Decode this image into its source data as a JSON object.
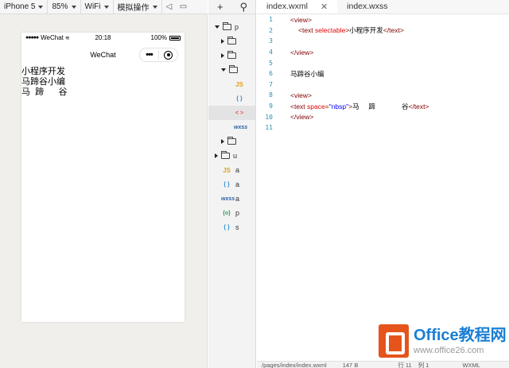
{
  "toolbar": {
    "device": "iPhone 5",
    "zoom": "85%",
    "network": "WiFi",
    "mode": "模拟操作"
  },
  "phone": {
    "carrier": "WeChat",
    "time": "20:18",
    "battery": "100%",
    "nav_title": "WeChat",
    "content": [
      "小程序开发",
      "马蹄谷小编",
      "马  蹄      谷"
    ]
  },
  "tree": {
    "rows": [
      "p",
      "",
      "",
      "",
      "JS",
      "{ }",
      "< >",
      "wxss",
      "",
      "u",
      "a",
      "a",
      "a",
      "p",
      "s"
    ]
  },
  "editor": {
    "tabs": [
      "index.wxml",
      "index.wxss"
    ],
    "lines": [
      {
        "num": "1",
        "parts": [
          [
            "kw",
            "<view>"
          ]
        ]
      },
      {
        "num": "2",
        "indent": true,
        "parts": [
          [
            "kw",
            "<text "
          ],
          [
            "at",
            "selectable"
          ],
          [
            "kw",
            ">"
          ],
          [
            "txt",
            "小程序开发"
          ],
          [
            "kw",
            "</text>"
          ]
        ]
      },
      {
        "num": "3",
        "parts": []
      },
      {
        "num": "4",
        "parts": [
          [
            "kw",
            "</view>"
          ]
        ]
      },
      {
        "num": "5",
        "parts": []
      },
      {
        "num": "6",
        "parts": [
          [
            "txt",
            "马蹄谷小编"
          ]
        ]
      },
      {
        "num": "7",
        "parts": []
      },
      {
        "num": "8",
        "parts": [
          [
            "kw",
            "<view>"
          ]
        ]
      },
      {
        "num": "9",
        "parts": [
          [
            "kw",
            "<text "
          ],
          [
            "at",
            "space"
          ],
          [
            "kw",
            "="
          ],
          [
            "str",
            "\"nbsp\""
          ],
          [
            "kw",
            ">"
          ],
          [
            "txt",
            "马     蹄              谷"
          ],
          [
            "kw",
            "</text>"
          ]
        ]
      },
      {
        "num": "10",
        "parts": [
          [
            "kw",
            "</view>"
          ]
        ]
      },
      {
        "num": "11",
        "parts": []
      }
    ]
  },
  "footer": {
    "path": "/pages/index/index.wxml",
    "size": "147 B",
    "row": "行 11",
    "col": "列 1",
    "lang": "WXML"
  },
  "watermark": {
    "brand": "Office教程网",
    "url": "www.office26.com"
  }
}
